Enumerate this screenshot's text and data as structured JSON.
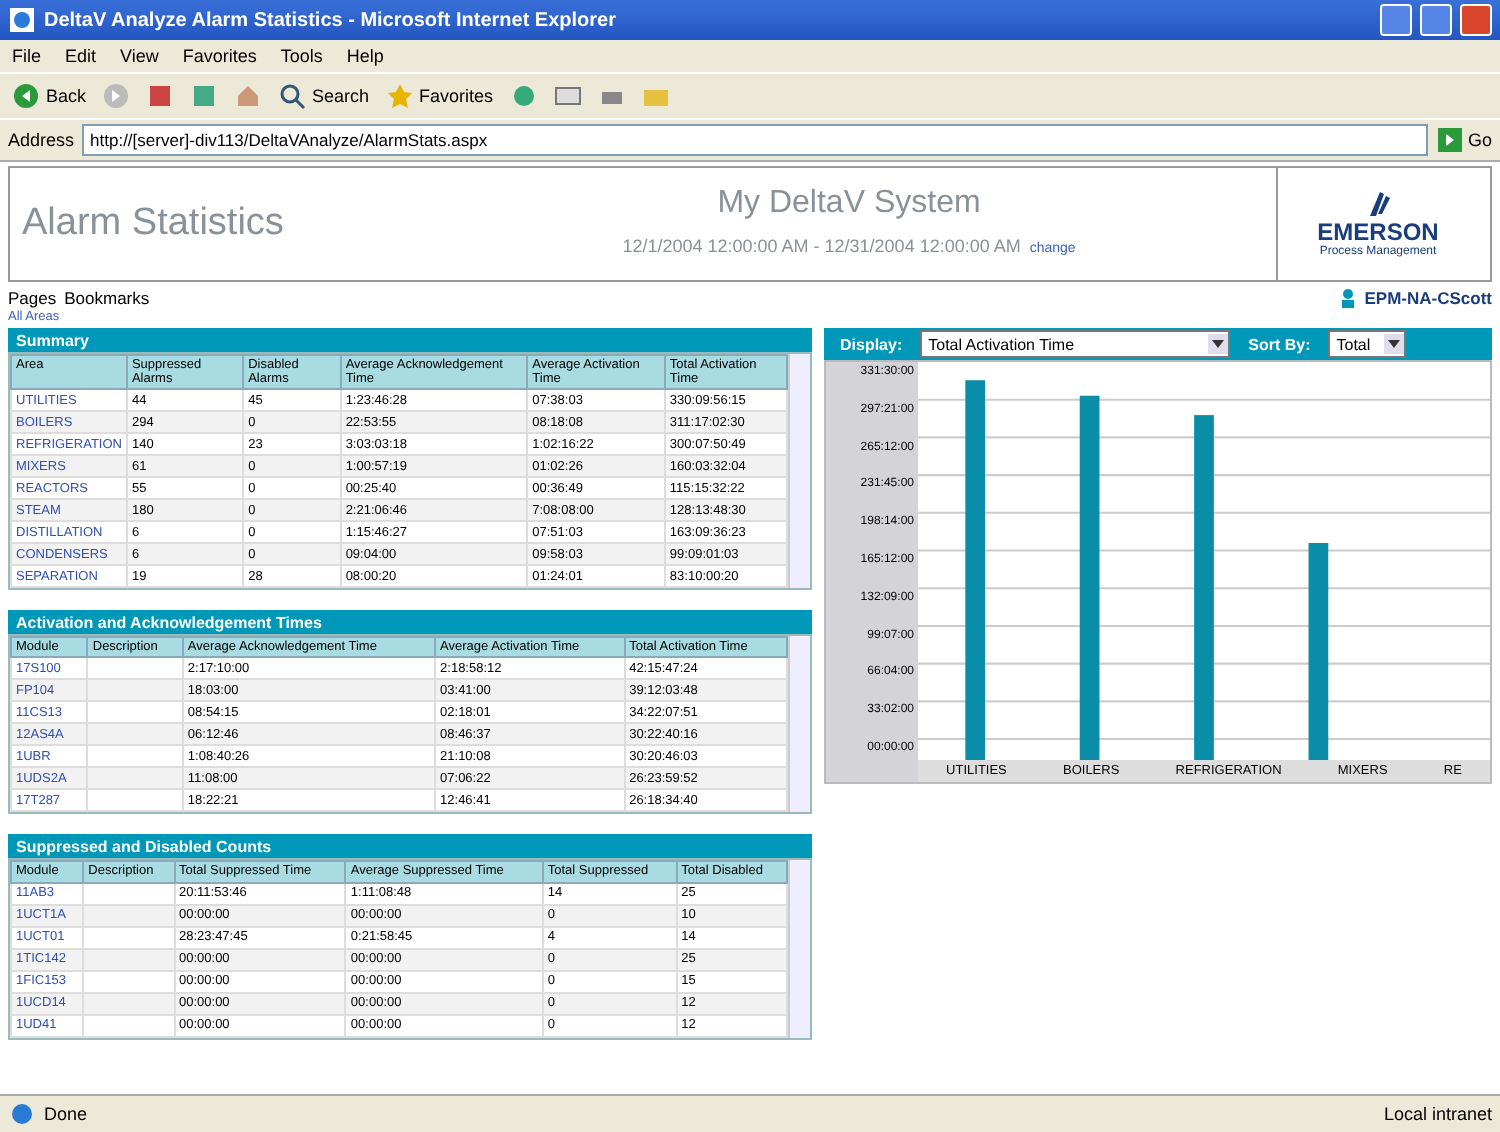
{
  "window": {
    "title": "DeltaV Analyze Alarm Statistics - Microsoft Internet Explorer"
  },
  "menu": [
    "File",
    "Edit",
    "View",
    "Favorites",
    "Tools",
    "Help"
  ],
  "toolbar": {
    "back": "Back",
    "search": "Search",
    "favorites": "Favorites"
  },
  "address": {
    "label": "Address",
    "url": "http://[server]-div113/DeltaVAnalyze/AlarmStats.aspx",
    "go": "Go"
  },
  "header": {
    "title": "Alarm Statistics",
    "system": "My DeltaV System",
    "range": "12/1/2004 12:00:00 AM - 12/31/2004 12:00:00 AM",
    "change": "change",
    "logo": "EMERSON",
    "logo_sub": "Process Management"
  },
  "nav": {
    "items": [
      "Pages",
      "Bookmarks"
    ],
    "user": "EPM-NA-CScott",
    "area": "All Areas"
  },
  "panels": [
    {
      "title": "Summary",
      "columns": [
        "Area",
        "Suppressed Alarms",
        "Disabled Alarms",
        "Average Acknowledgement Time",
        "Average Activation Time",
        "Total Activation Time"
      ],
      "rows": [
        [
          "UTILITIES",
          "44",
          "45",
          "1:23:46:28",
          "07:38:03",
          "330:09:56:15"
        ],
        [
          "BOILERS",
          "294",
          "0",
          "22:53:55",
          "08:18:08",
          "311:17:02:30"
        ],
        [
          "REFRIGERATION",
          "140",
          "23",
          "3:03:03:18",
          "1:02:16:22",
          "300:07:50:49"
        ],
        [
          "MIXERS",
          "61",
          "0",
          "1:00:57:19",
          "01:02:26",
          "160:03:32:04"
        ],
        [
          "REACTORS",
          "55",
          "0",
          "00:25:40",
          "00:36:49",
          "115:15:32:22"
        ],
        [
          "STEAM",
          "180",
          "0",
          "2:21:06:46",
          "7:08:08:00",
          "128:13:48:30"
        ],
        [
          "DISTILLATION",
          "6",
          "0",
          "1:15:46:27",
          "07:51:03",
          "163:09:36:23"
        ],
        [
          "CONDENSERS",
          "6",
          "0",
          "09:04:00",
          "09:58:03",
          "99:09:01:03"
        ],
        [
          "SEPARATION",
          "19",
          "28",
          "08:00:20",
          "01:24:01",
          "83:10:00:20"
        ]
      ]
    },
    {
      "title": "Activation and Acknowledgement Times",
      "columns": [
        "Module",
        "Description",
        "Average Acknowledgement Time",
        "Average Activation Time",
        "Total Activation Time"
      ],
      "rows": [
        [
          "17S100",
          "",
          "2:17:10:00",
          "2:18:58:12",
          "42:15:47:24"
        ],
        [
          "FP104",
          "",
          "18:03:00",
          "03:41:00",
          "39:12:03:48"
        ],
        [
          "11CS13",
          "",
          "08:54:15",
          "02:18:01",
          "34:22:07:51"
        ],
        [
          "12AS4A",
          "",
          "06:12:46",
          "08:46:37",
          "30:22:40:16"
        ],
        [
          "1UBR",
          "",
          "1:08:40:26",
          "21:10:08",
          "30:20:46:03"
        ],
        [
          "1UDS2A",
          "",
          "11:08:00",
          "07:06:22",
          "26:23:59:52"
        ],
        [
          "17T287",
          "",
          "18:22:21",
          "12:46:41",
          "26:18:34:40"
        ]
      ]
    },
    {
      "title": "Suppressed and Disabled Counts",
      "columns": [
        "Module",
        "Description",
        "Total Suppressed Time",
        "Average Suppressed Time",
        "Total Suppressed",
        "Total Disabled"
      ],
      "rows": [
        [
          "11AB3",
          "",
          "20:11:53:46",
          "1:11:08:48",
          "14",
          "25"
        ],
        [
          "1UCT1A",
          "",
          "00:00:00",
          "00:00:00",
          "0",
          "10"
        ],
        [
          "1UCT01",
          "",
          "28:23:47:45",
          "0:21:58:45",
          "4",
          "14"
        ],
        [
          "1TIC142",
          "",
          "00:00:00",
          "00:00:00",
          "0",
          "25"
        ],
        [
          "1FIC153",
          "",
          "00:00:00",
          "00:00:00",
          "0",
          "15"
        ],
        [
          "1UCD14",
          "",
          "00:00:00",
          "00:00:00",
          "0",
          "12"
        ],
        [
          "1UD41",
          "",
          "00:00:00",
          "00:00:00",
          "0",
          "12"
        ]
      ]
    }
  ],
  "chart_panel": {
    "display_label": "Display:",
    "display_value": "Total Activation Time",
    "sort_label": "Sort By:",
    "sort_value": "Total",
    "y_tick_labels": [
      "331:30:00",
      "297:21:00",
      "265:12:00",
      "231:45:00",
      "198:14:00",
      "165:12:00",
      "132:09:00",
      "99:07:00",
      "66:04:00",
      "33:02:00",
      "00:00:00"
    ],
    "categories": [
      "UTILITIES",
      "BOILERS",
      "REFRIGERATION",
      "MIXERS",
      "RE"
    ]
  },
  "status_bar": {
    "text": "Done",
    "zone": "Local intranet"
  }
}
